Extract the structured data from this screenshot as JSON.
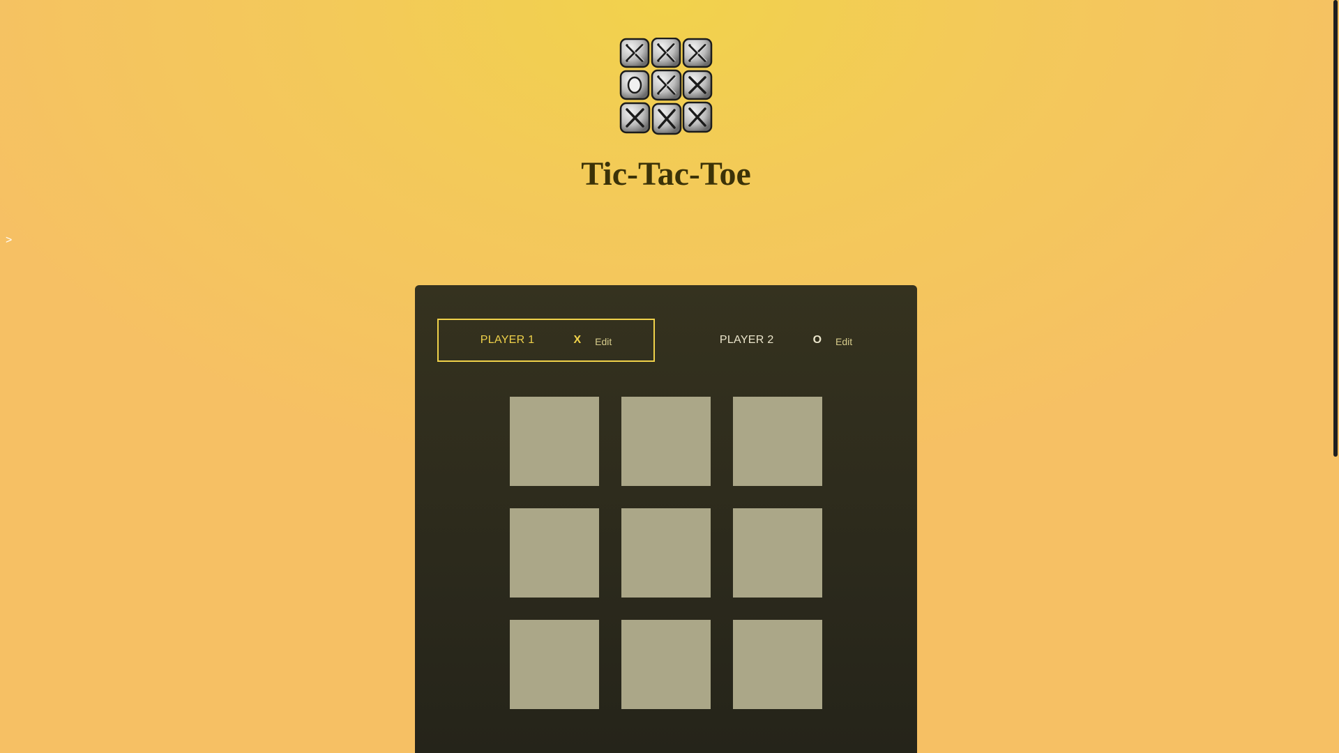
{
  "app": {
    "title": "Tic-Tac-Toe",
    "sidebar_toggle": ">"
  },
  "players": [
    {
      "name": "PLAYER 1",
      "symbol": "X",
      "edit_label": "Edit",
      "active": true
    },
    {
      "name": "PLAYER 2",
      "symbol": "O",
      "edit_label": "Edit",
      "active": false
    }
  ],
  "board": {
    "cells": [
      "",
      "",
      "",
      "",
      "",
      "",
      "",
      "",
      ""
    ]
  },
  "colors": {
    "background": "#f3c95a",
    "panel": "#2f2d1f",
    "cell": "#aba788",
    "accent": "#f0d24a",
    "title": "#3b3208"
  },
  "icons": {
    "logo": "tic-tac-toe-logo-icon"
  }
}
